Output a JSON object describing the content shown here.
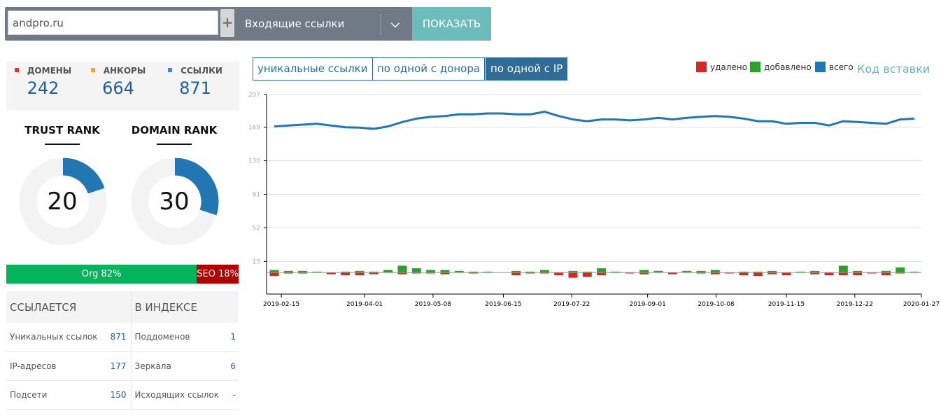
{
  "search": {
    "domain_value": "andpro.ru",
    "plus_label": "+",
    "report_type": "Входящие ссылки",
    "dropdown_icon": "chevron-down",
    "show_label": "ПОКАЗАТЬ"
  },
  "counts": [
    {
      "label": "ДОМЕНЫ",
      "value": "242",
      "color": "#e8312f"
    },
    {
      "label": "АНКОРЫ",
      "value": "664",
      "color": "#f5a623"
    },
    {
      "label": "ССЫЛКИ",
      "value": "871",
      "color": "#4a7ee8"
    }
  ],
  "ranks": [
    {
      "title": "TRUST RANK",
      "value": "20",
      "percent": 20
    },
    {
      "title": "DOMAIN RANK",
      "value": "30",
      "percent": 30
    }
  ],
  "traffic": {
    "org_label": "Org 82%",
    "org_percent": 82,
    "seo_label": "SEO 18%",
    "seo_percent": 18
  },
  "stats": {
    "headers": [
      "ССЫЛАЕТСЯ",
      "В ИНДЕКСЕ"
    ],
    "rows": [
      {
        "l1": "Уникальных ссылок",
        "v1": "871",
        "l2": "Поддоменов",
        "v2": "1"
      },
      {
        "l1": "IP-адресов",
        "v1": "177",
        "l2": "Зеркала",
        "v2": "6"
      },
      {
        "l1": "Подсети",
        "v1": "150",
        "l2": "Исходящих ссылок",
        "v2": "-"
      }
    ]
  },
  "tabs": [
    {
      "label": "уникальные ссылки",
      "active": false
    },
    {
      "label": "по одной с донора",
      "active": false
    },
    {
      "label": "по одной с IP",
      "active": true
    }
  ],
  "legend": [
    {
      "label": "удалено",
      "color": "#d62728"
    },
    {
      "label": "добавлено",
      "color": "#2ca02c"
    },
    {
      "label": "всего",
      "color": "#1f77b4"
    }
  ],
  "embed_label": "Код вставки",
  "chart_data": {
    "type": "line+bar",
    "yticks": [
      13,
      52,
      91,
      130,
      169,
      207
    ],
    "ylim": [
      -25,
      207
    ],
    "xlim": [
      "2019-02-07",
      "2020-01-27"
    ],
    "xticks": [
      "2019-02-15",
      "2019-04-01",
      "2019-05-08",
      "2019-06-15",
      "2019-07-22",
      "2019-09-01",
      "2019-10-08",
      "2019-11-15",
      "2019-12-22",
      "2020-01-27"
    ],
    "grid": true,
    "series": [
      {
        "name": "всего",
        "type": "line",
        "values": [
          170,
          171,
          172,
          173,
          171,
          169,
          168.5,
          167,
          170,
          175,
          179,
          181,
          182,
          184,
          184,
          185,
          185,
          184,
          184,
          187,
          182,
          178,
          176,
          178,
          178,
          177,
          178,
          180,
          178,
          180,
          181,
          182,
          181,
          179,
          176,
          176,
          173,
          174,
          174,
          171,
          176,
          175,
          174,
          173,
          178,
          179
        ]
      },
      {
        "name": "добавлено",
        "type": "bar",
        "values": [
          3,
          2,
          2,
          1,
          0,
          1,
          2,
          1,
          3,
          8,
          5,
          3,
          3,
          2,
          1,
          1,
          0,
          2,
          1,
          3,
          0,
          2,
          1,
          5,
          1,
          0,
          3,
          2,
          0,
          2,
          2,
          3,
          0,
          1,
          1,
          2,
          0,
          1,
          2,
          0,
          8,
          2,
          0,
          2,
          6,
          1
        ]
      },
      {
        "name": "удалено",
        "type": "bar",
        "values": [
          4,
          1,
          1,
          0,
          2,
          3,
          3,
          2,
          0,
          2,
          1,
          1,
          2,
          0,
          1,
          0,
          0,
          3,
          1,
          1,
          3,
          6,
          5,
          3,
          0,
          1,
          2,
          0,
          2,
          0,
          1,
          2,
          1,
          3,
          4,
          2,
          3,
          0,
          2,
          3,
          3,
          3,
          1,
          3,
          1,
          0
        ]
      }
    ]
  }
}
